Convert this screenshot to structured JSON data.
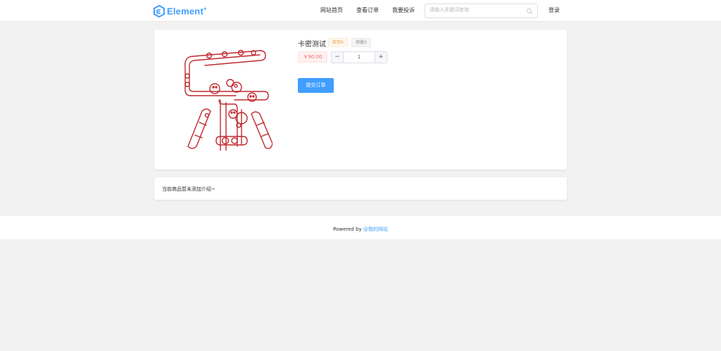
{
  "header": {
    "logo_text": "Element",
    "logo_plus": "+",
    "nav": [
      {
        "label": "网站首页"
      },
      {
        "label": "查看订单"
      },
      {
        "label": "我要投诉"
      }
    ],
    "search_placeholder": "请输入关键词查询",
    "login_label": "登录"
  },
  "product": {
    "title": "卡密测试",
    "stock_tag": "库存6",
    "sales_tag": "销量0",
    "price": "￥90.00",
    "quantity": "1",
    "minus_label": "−",
    "plus_label": "+",
    "submit_label": "提交订单"
  },
  "description": {
    "text": "当前商品暂未添加介绍~"
  },
  "footer": {
    "powered_by": "Powered by",
    "link_text": "@我的网站"
  },
  "colors": {
    "primary": "#409eff",
    "danger": "#f56c6c",
    "warning": "#e6a23c",
    "image_stroke": "#c0282d"
  }
}
